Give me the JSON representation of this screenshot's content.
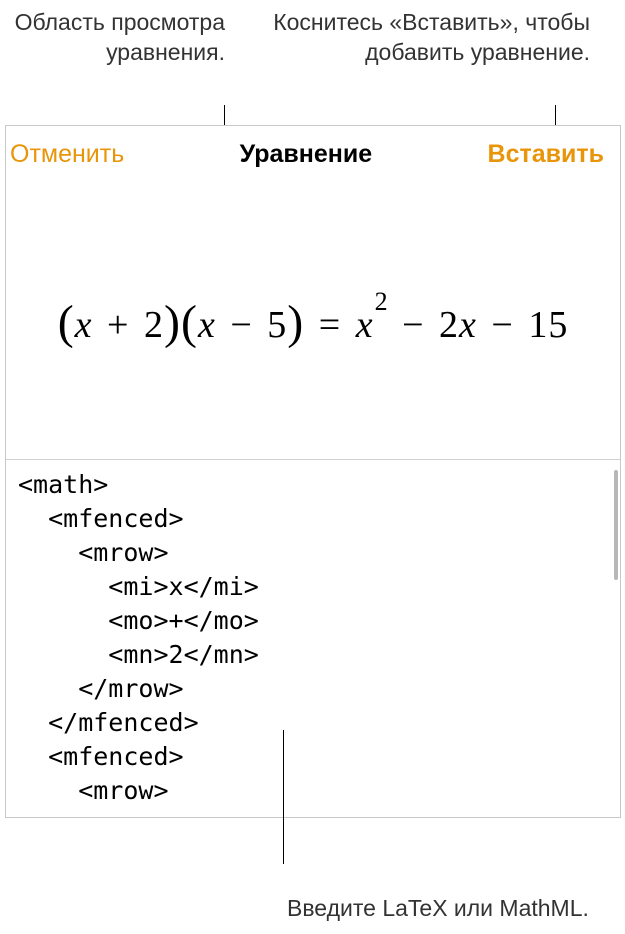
{
  "callouts": {
    "preview": "Область просмотра уравнения.",
    "insert": "Коснитесь «Вставить», чтобы добавить уравнение.",
    "input": "Введите LaTeX или MathML."
  },
  "dialog": {
    "cancel": "Отменить",
    "title": "Уравнение",
    "insert": "Вставить"
  },
  "equation": {
    "rendered_parts": {
      "p1o": "(",
      "x1": "x",
      "op1": " + ",
      "n1": "2",
      "p1c": ")",
      "p2o": "(",
      "x2": "x",
      "op2": " − ",
      "n2": "5",
      "p2c": ")",
      "eq": " = ",
      "x3": "x",
      "sup": "2",
      "op3": " − ",
      "n3": "2",
      "x4": "x",
      "op4": " − ",
      "n4": "15"
    }
  },
  "code_lines": {
    "l1": "<math>",
    "l2": "  <mfenced>",
    "l3": "    <mrow>",
    "l4": "      <mi>x</mi>",
    "l5": "      <mo>+</mo>",
    "l6": "      <mn>2</mn>",
    "l7": "    </mrow>",
    "l8": "  </mfenced>",
    "l9": "  <mfenced>",
    "l10": "    <mrow>"
  },
  "chart_data": {
    "type": "table",
    "description": "Rendered equation and source MathML",
    "equation_display": "(x + 2)(x − 5) = x² − 2x − 15",
    "source_format": "MathML",
    "source_lines": [
      "<math>",
      "  <mfenced>",
      "    <mrow>",
      "      <mi>x</mi>",
      "      <mo>+</mo>",
      "      <mn>2</mn>",
      "    </mrow>",
      "  </mfenced>",
      "  <mfenced>",
      "    <mrow>"
    ]
  }
}
